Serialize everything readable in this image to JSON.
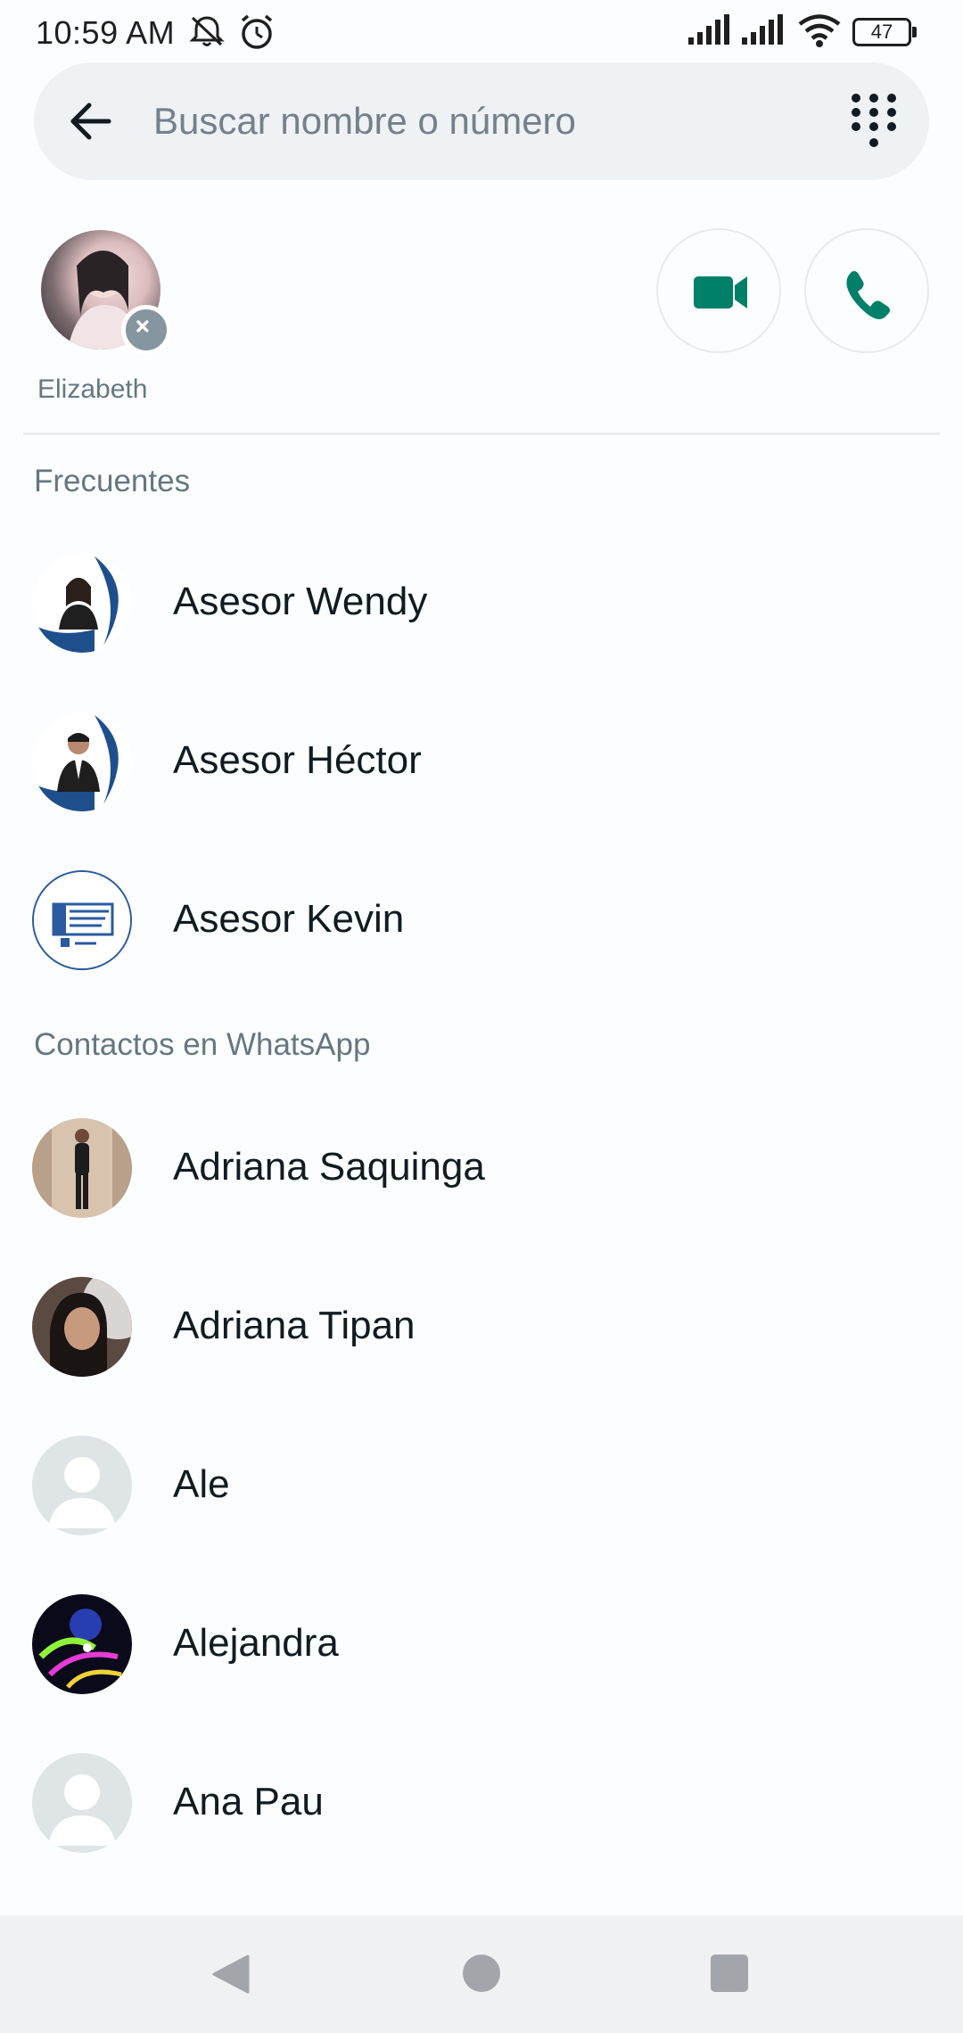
{
  "status_bar": {
    "time": "10:59 AM",
    "battery": "47"
  },
  "search": {
    "placeholder": "Buscar nombre o número",
    "value": ""
  },
  "selected": {
    "name": "Elizabeth"
  },
  "sections": {
    "frequent": "Frecuentes",
    "contacts": "Contactos en WhatsApp"
  },
  "frequent": [
    {
      "name": "Asesor Wendy"
    },
    {
      "name": "Asesor Héctor"
    },
    {
      "name": "Asesor Kevin"
    }
  ],
  "contacts": [
    {
      "name": "Adriana Saquinga"
    },
    {
      "name": "Adriana Tipan"
    },
    {
      "name": "Ale"
    },
    {
      "name": "Alejandra"
    },
    {
      "name": "Ana Pau"
    }
  ],
  "colors": {
    "accent": "#008069",
    "search_bg": "#eff2f5",
    "secondary_text": "#667781"
  },
  "icons": [
    "back-arrow-icon",
    "dialpad-icon",
    "remove-icon",
    "video-call-icon",
    "voice-call-icon",
    "default-avatar-icon",
    "nav-back-icon",
    "nav-home-icon",
    "nav-recents-icon"
  ]
}
